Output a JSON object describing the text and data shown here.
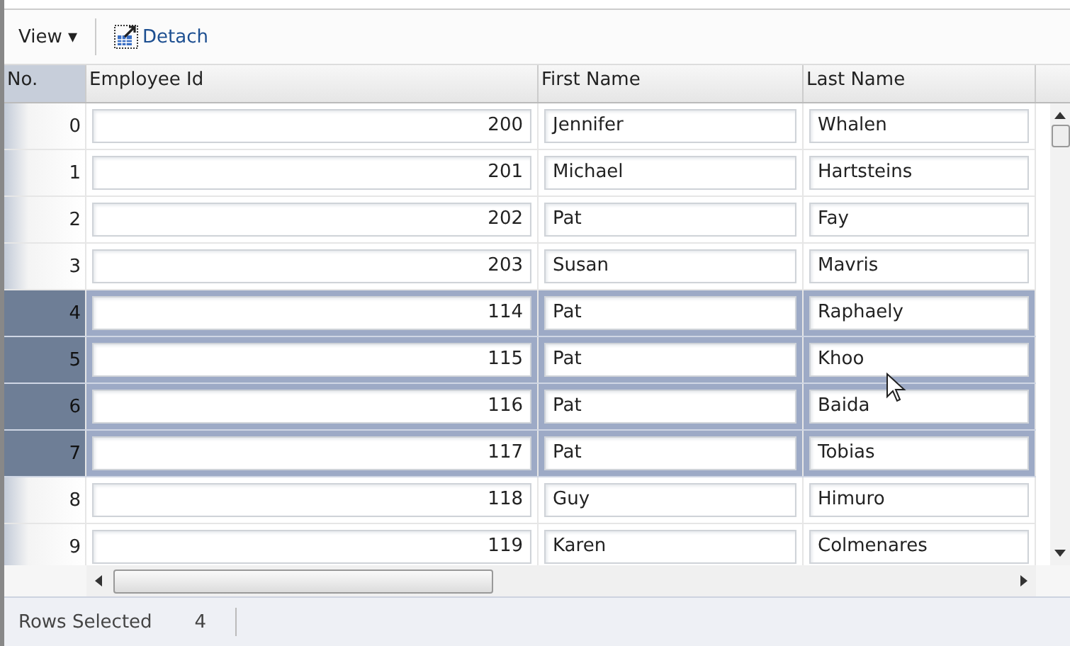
{
  "toolbar": {
    "view_menu": "View ▾",
    "detach_button": "Detach"
  },
  "table": {
    "columns": [
      "No.",
      "Employee Id",
      "First Name",
      "Last Name"
    ],
    "rows": [
      {
        "no": "0",
        "employee_id": "200",
        "first_name": "Jennifer",
        "last_name": "Whalen",
        "selected": false
      },
      {
        "no": "1",
        "employee_id": "201",
        "first_name": "Michael",
        "last_name": "Hartsteins",
        "selected": false
      },
      {
        "no": "2",
        "employee_id": "202",
        "first_name": "Pat",
        "last_name": "Fay",
        "selected": false
      },
      {
        "no": "3",
        "employee_id": "203",
        "first_name": "Susan",
        "last_name": "Mavris",
        "selected": false
      },
      {
        "no": "4",
        "employee_id": "114",
        "first_name": "Pat",
        "last_name": "Raphaely",
        "selected": true
      },
      {
        "no": "5",
        "employee_id": "115",
        "first_name": "Pat",
        "last_name": "Khoo",
        "selected": true
      },
      {
        "no": "6",
        "employee_id": "116",
        "first_name": "Pat",
        "last_name": "Baida",
        "selected": true
      },
      {
        "no": "7",
        "employee_id": "117",
        "first_name": "Pat",
        "last_name": "Tobias",
        "selected": true
      },
      {
        "no": "8",
        "employee_id": "118",
        "first_name": "Guy",
        "last_name": "Himuro",
        "selected": false
      },
      {
        "no": "9",
        "employee_id": "119",
        "first_name": "Karen",
        "last_name": "Colmenares",
        "selected": false
      }
    ]
  },
  "status_bar": {
    "label": "Rows Selected",
    "value": "4"
  }
}
